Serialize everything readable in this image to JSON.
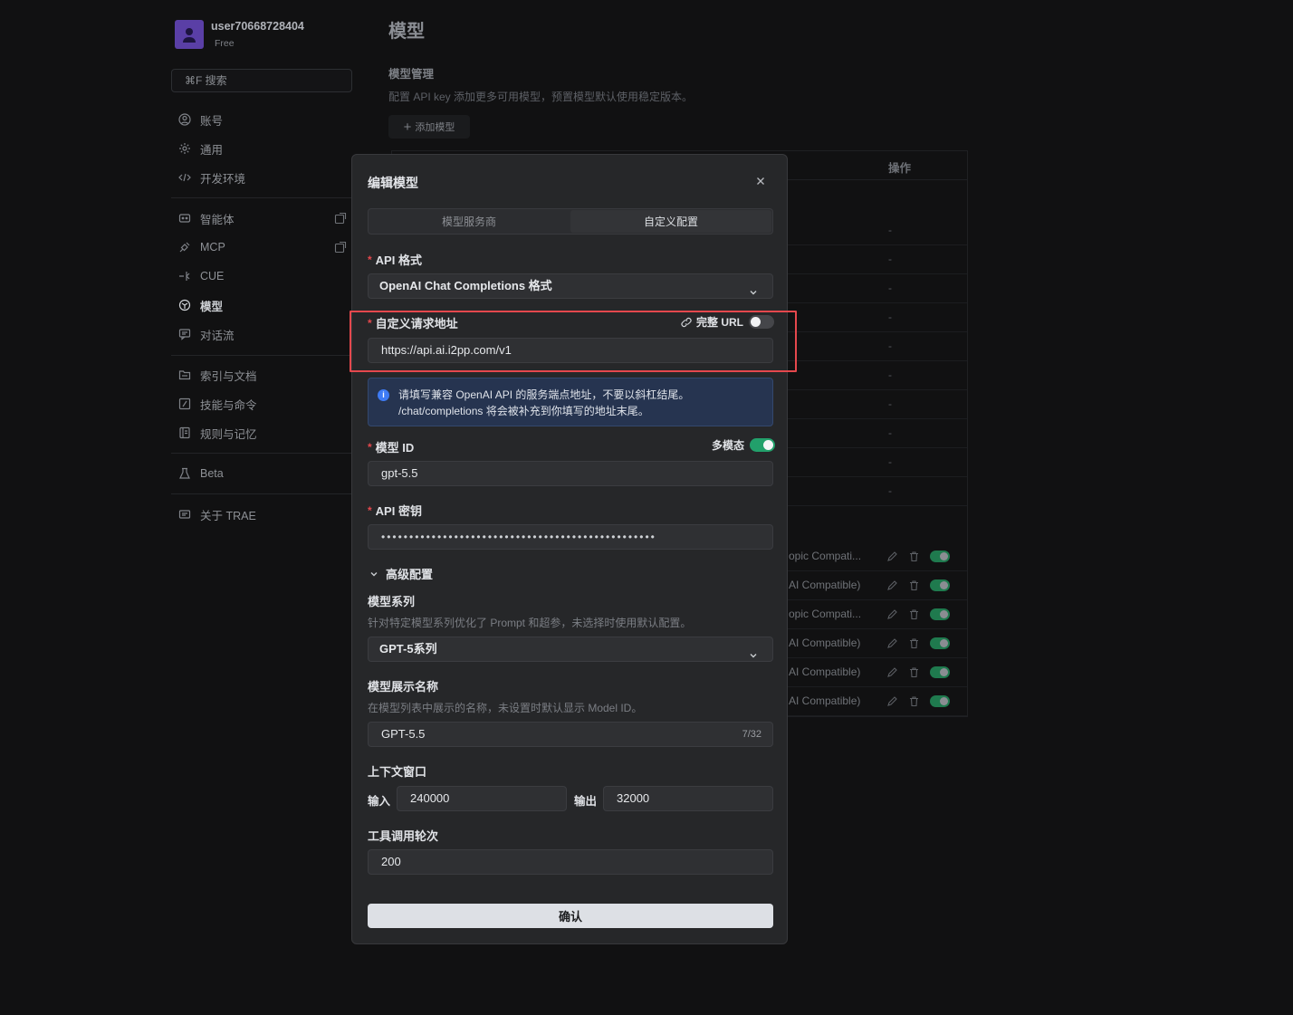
{
  "user": {
    "name": "user70668728404",
    "plan": "Free"
  },
  "search": {
    "placeholder": "⌘F 搜索"
  },
  "sidebar": {
    "items": [
      {
        "label": "账号",
        "icon": "account-icon"
      },
      {
        "label": "通用",
        "icon": "gear-icon"
      },
      {
        "label": "开发环境",
        "icon": "code-icon"
      },
      {
        "label": "智能体",
        "icon": "agent-icon"
      },
      {
        "label": "MCP",
        "icon": "plug-icon"
      },
      {
        "label": "CUE",
        "icon": "cue-icon"
      },
      {
        "label": "模型",
        "icon": "model-icon"
      },
      {
        "label": "对话流",
        "icon": "chat-icon"
      },
      {
        "label": "索引与文档",
        "icon": "folder-icon"
      },
      {
        "label": "技能与命令",
        "icon": "skill-icon"
      },
      {
        "label": "规则与记忆",
        "icon": "book-icon"
      },
      {
        "label": "Beta",
        "icon": "beaker-icon"
      },
      {
        "label": "关于 TRAE",
        "icon": "info-icon"
      }
    ]
  },
  "main": {
    "title": "模型",
    "section_title": "模型管理",
    "section_desc": "配置 API key 添加更多可用模型，预置模型默认使用稳定版本。",
    "add_button": "添加模型",
    "ops_header": "操作",
    "dash_rows": [
      "-",
      "-",
      "-",
      "-",
      "-",
      "-",
      "-",
      "-",
      "-",
      "-"
    ],
    "custom_rows": [
      "opic Compati...",
      "AI Compatible)",
      "opic Compati...",
      "AI Compatible)",
      "AI Compatible)",
      "AI Compatible)"
    ]
  },
  "modal": {
    "title": "编辑模型",
    "tabs": [
      "模型服务商",
      "自定义配置"
    ],
    "api_format_label": "API 格式",
    "api_format_value": "OpenAI Chat Completions 格式",
    "url_label": "自定义请求地址",
    "full_url_label": "完整 URL",
    "url_value": "https://api.ai.i2pp.com/v1",
    "info_line1": "请填写兼容 OpenAI API 的服务端点地址，不要以斜杠结尾。",
    "info_line2": "/chat/completions 将会被补充到你填写的地址末尾。",
    "model_id_label": "模型 ID",
    "multimodal_label": "多模态",
    "model_id_value": "gpt-5.5",
    "api_key_label": "API 密钥",
    "api_key_masked": "•••••••••••••••••••••••••••••••••••••••••••••••••",
    "advanced_label": "高级配置",
    "series_label": "模型系列",
    "series_hint": "针对特定模型系列优化了 Prompt 和超参，未选择时使用默认配置。",
    "series_value": "GPT-5系列",
    "display_name_label": "模型展示名称",
    "display_name_hint": "在模型列表中展示的名称，未设置时默认显示 Model ID。",
    "display_name_value": "GPT-5.5",
    "display_name_counter": "7/32",
    "context_label": "上下文窗口",
    "input_label": "输入",
    "input_value": "240000",
    "output_label": "输出",
    "output_value": "32000",
    "tool_rounds_label": "工具调用轮次",
    "tool_rounds_value": "200",
    "confirm_label": "确认"
  },
  "colors": {
    "accent_green": "#22a06b",
    "highlight_red": "#e5484d",
    "info_blue": "#3e7bf5"
  }
}
